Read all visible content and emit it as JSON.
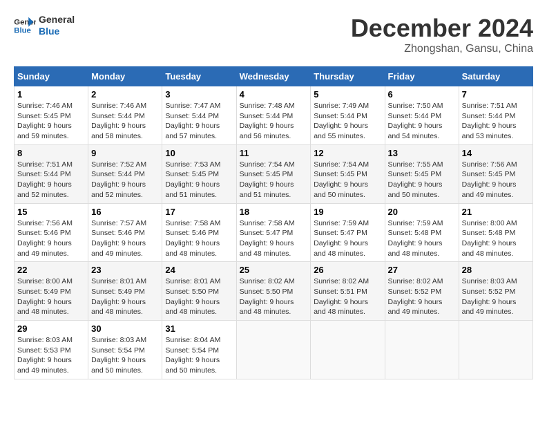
{
  "logo": {
    "line1": "General",
    "line2": "Blue"
  },
  "title": "December 2024",
  "location": "Zhongshan, Gansu, China",
  "days_of_week": [
    "Sunday",
    "Monday",
    "Tuesday",
    "Wednesday",
    "Thursday",
    "Friday",
    "Saturday"
  ],
  "weeks": [
    [
      {
        "day": 1,
        "sunrise": "7:46 AM",
        "sunset": "5:45 PM",
        "daylight": "9 hours and 59 minutes."
      },
      {
        "day": 2,
        "sunrise": "7:46 AM",
        "sunset": "5:44 PM",
        "daylight": "9 hours and 58 minutes."
      },
      {
        "day": 3,
        "sunrise": "7:47 AM",
        "sunset": "5:44 PM",
        "daylight": "9 hours and 57 minutes."
      },
      {
        "day": 4,
        "sunrise": "7:48 AM",
        "sunset": "5:44 PM",
        "daylight": "9 hours and 56 minutes."
      },
      {
        "day": 5,
        "sunrise": "7:49 AM",
        "sunset": "5:44 PM",
        "daylight": "9 hours and 55 minutes."
      },
      {
        "day": 6,
        "sunrise": "7:50 AM",
        "sunset": "5:44 PM",
        "daylight": "9 hours and 54 minutes."
      },
      {
        "day": 7,
        "sunrise": "7:51 AM",
        "sunset": "5:44 PM",
        "daylight": "9 hours and 53 minutes."
      }
    ],
    [
      {
        "day": 8,
        "sunrise": "7:51 AM",
        "sunset": "5:44 PM",
        "daylight": "9 hours and 52 minutes."
      },
      {
        "day": 9,
        "sunrise": "7:52 AM",
        "sunset": "5:44 PM",
        "daylight": "9 hours and 52 minutes."
      },
      {
        "day": 10,
        "sunrise": "7:53 AM",
        "sunset": "5:45 PM",
        "daylight": "9 hours and 51 minutes."
      },
      {
        "day": 11,
        "sunrise": "7:54 AM",
        "sunset": "5:45 PM",
        "daylight": "9 hours and 51 minutes."
      },
      {
        "day": 12,
        "sunrise": "7:54 AM",
        "sunset": "5:45 PM",
        "daylight": "9 hours and 50 minutes."
      },
      {
        "day": 13,
        "sunrise": "7:55 AM",
        "sunset": "5:45 PM",
        "daylight": "9 hours and 50 minutes."
      },
      {
        "day": 14,
        "sunrise": "7:56 AM",
        "sunset": "5:45 PM",
        "daylight": "9 hours and 49 minutes."
      }
    ],
    [
      {
        "day": 15,
        "sunrise": "7:56 AM",
        "sunset": "5:46 PM",
        "daylight": "9 hours and 49 minutes."
      },
      {
        "day": 16,
        "sunrise": "7:57 AM",
        "sunset": "5:46 PM",
        "daylight": "9 hours and 49 minutes."
      },
      {
        "day": 17,
        "sunrise": "7:58 AM",
        "sunset": "5:46 PM",
        "daylight": "9 hours and 48 minutes."
      },
      {
        "day": 18,
        "sunrise": "7:58 AM",
        "sunset": "5:47 PM",
        "daylight": "9 hours and 48 minutes."
      },
      {
        "day": 19,
        "sunrise": "7:59 AM",
        "sunset": "5:47 PM",
        "daylight": "9 hours and 48 minutes."
      },
      {
        "day": 20,
        "sunrise": "7:59 AM",
        "sunset": "5:48 PM",
        "daylight": "9 hours and 48 minutes."
      },
      {
        "day": 21,
        "sunrise": "8:00 AM",
        "sunset": "5:48 PM",
        "daylight": "9 hours and 48 minutes."
      }
    ],
    [
      {
        "day": 22,
        "sunrise": "8:00 AM",
        "sunset": "5:49 PM",
        "daylight": "9 hours and 48 minutes."
      },
      {
        "day": 23,
        "sunrise": "8:01 AM",
        "sunset": "5:49 PM",
        "daylight": "9 hours and 48 minutes."
      },
      {
        "day": 24,
        "sunrise": "8:01 AM",
        "sunset": "5:50 PM",
        "daylight": "9 hours and 48 minutes."
      },
      {
        "day": 25,
        "sunrise": "8:02 AM",
        "sunset": "5:50 PM",
        "daylight": "9 hours and 48 minutes."
      },
      {
        "day": 26,
        "sunrise": "8:02 AM",
        "sunset": "5:51 PM",
        "daylight": "9 hours and 48 minutes."
      },
      {
        "day": 27,
        "sunrise": "8:02 AM",
        "sunset": "5:52 PM",
        "daylight": "9 hours and 49 minutes."
      },
      {
        "day": 28,
        "sunrise": "8:03 AM",
        "sunset": "5:52 PM",
        "daylight": "9 hours and 49 minutes."
      }
    ],
    [
      {
        "day": 29,
        "sunrise": "8:03 AM",
        "sunset": "5:53 PM",
        "daylight": "9 hours and 49 minutes."
      },
      {
        "day": 30,
        "sunrise": "8:03 AM",
        "sunset": "5:54 PM",
        "daylight": "9 hours and 50 minutes."
      },
      {
        "day": 31,
        "sunrise": "8:04 AM",
        "sunset": "5:54 PM",
        "daylight": "9 hours and 50 minutes."
      },
      null,
      null,
      null,
      null
    ]
  ]
}
